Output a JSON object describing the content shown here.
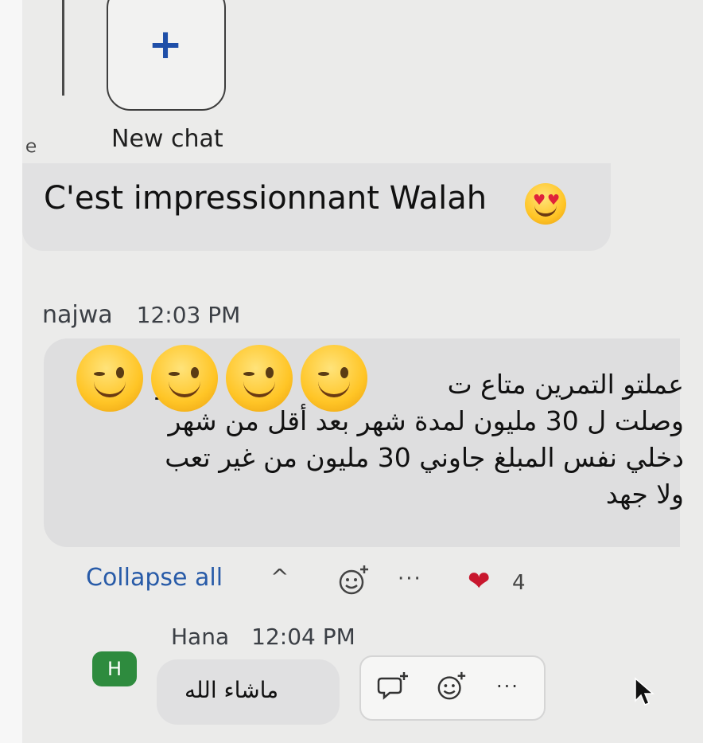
{
  "sidebar": {
    "new_chat_icon": "plus-icon",
    "new_chat_label": "New chat"
  },
  "messages": [
    {
      "text": "C'est impressionnant Walah",
      "emoji": "heart-eyes-emoji"
    },
    {
      "sender": "najwa",
      "time": "12:03 PM",
      "lines": [
        "عملتو التمرين متاع ت",
        "وصلت ل 30 مليون لمدة شهر بعد أقل من شهر",
        "دخلي نفس المبلغ جاوني 30 مليون من غير تعب",
        "ولا جهد"
      ],
      "line1_end": "و",
      "overlay_emoji": "winking-face-emoji",
      "actions": {
        "collapse_label": "Collapse all",
        "caret": "^",
        "more": "···",
        "reaction_icon": "heart-icon",
        "reaction_count": "4"
      }
    },
    {
      "sender": "Hana",
      "avatar_letter": "H",
      "time": "12:04 PM",
      "text": "ماشاء الله",
      "toolbar": {
        "more": "···"
      }
    }
  ],
  "colors": {
    "link": "#285ba8",
    "accent_blue": "#1f4fa8",
    "avatar_green": "#2e8b3e",
    "heart_red": "#c8172e"
  }
}
